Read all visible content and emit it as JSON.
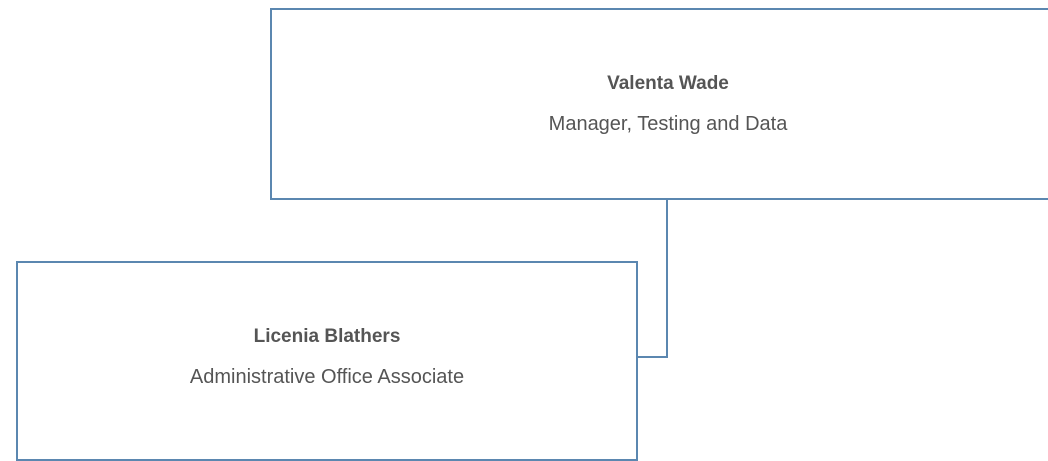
{
  "chart": {
    "nodes": [
      {
        "id": "manager",
        "name": "Valenta Wade",
        "title": "Manager, Testing and Data",
        "border_color": "#5b87b0"
      },
      {
        "id": "associate",
        "name": "Licenia Blathers",
        "title": "Administrative Office Associate",
        "border_color": "#5b87b0",
        "reports_to": "manager"
      }
    ],
    "connector_color": "#5b87b0",
    "text_color": "#555555"
  }
}
